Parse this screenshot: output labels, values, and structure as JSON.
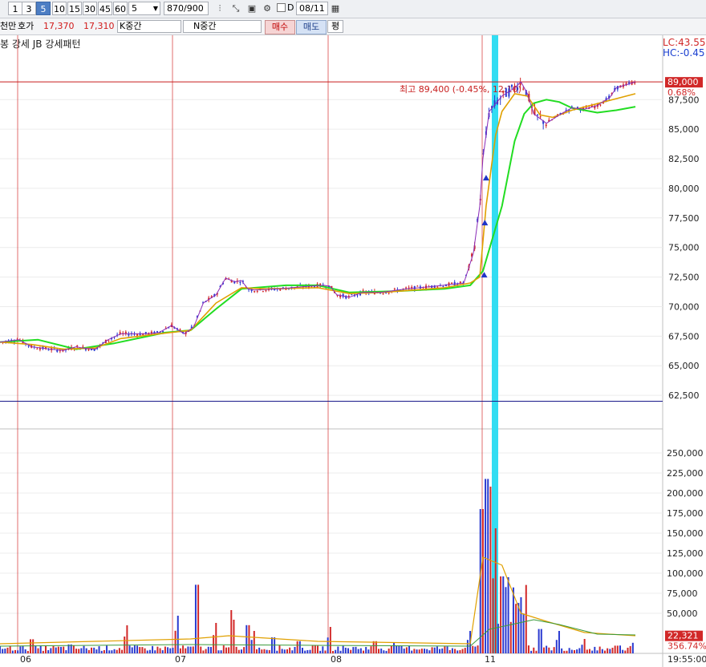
{
  "toolbar": {
    "period_buttons": [
      {
        "label": "1",
        "active": false
      },
      {
        "label": "3",
        "active": false
      },
      {
        "label": "5",
        "active": true
      },
      {
        "label": "10",
        "active": false
      },
      {
        "label": "15",
        "active": false
      },
      {
        "label": "30",
        "active": false
      },
      {
        "label": "45",
        "active": false
      },
      {
        "label": "60",
        "active": false
      }
    ],
    "interval_value": "5",
    "count_value": "870",
    "count_total": "/900",
    "checkbox_label": "D",
    "date_value": "08/11"
  },
  "quote_bar": {
    "left_label": "천만",
    "hoga_label": "호가",
    "ask_price": "17,370",
    "bid_price": "17,310",
    "k_label": "K중간",
    "n_label": "N중간",
    "buy_label": "매수",
    "sell_label": "매도",
    "extra_label": "평"
  },
  "indicator_title": "봉 강세 JB 강세패턴",
  "colors": {
    "accent_cyan": "#33ddf2",
    "ma_short": "#1a33c8",
    "ma_mid": "#e0a000",
    "ma_long": "#22dd22",
    "up": "#d22828",
    "down": "#2a3ad0",
    "grid": "#ececec"
  },
  "chart_data": {
    "type": "candlestick",
    "date_labels": [
      "06",
      "07",
      "08",
      "11"
    ],
    "price_axis": {
      "ticks": [
        "87,500",
        "85,000",
        "82,500",
        "80,000",
        "77,500",
        "75,000",
        "72,500",
        "70,000",
        "67,500",
        "65,000",
        "62,500"
      ],
      "range": [
        60000,
        90500
      ],
      "current_label": "89,000",
      "current_pct": "0.68%",
      "lc_label": "LC:43.55",
      "hc_label": "HC:-0.45"
    },
    "high_annotation": "최고 89,400 (-0.45%, 12:10)",
    "price_reference": 89000,
    "support_reference": 62000,
    "price_path": [
      [
        0,
        67000
      ],
      [
        0.03,
        67200
      ],
      [
        0.05,
        66600
      ],
      [
        0.08,
        66400
      ],
      [
        0.1,
        66300
      ],
      [
        0.12,
        66600
      ],
      [
        0.13,
        66500
      ],
      [
        0.15,
        66400
      ],
      [
        0.17,
        67200
      ],
      [
        0.19,
        67700
      ],
      [
        0.23,
        67700
      ],
      [
        0.25,
        67800
      ],
      [
        0.27,
        68400
      ],
      [
        0.29,
        67700
      ],
      [
        0.305,
        68300
      ],
      [
        0.32,
        70300
      ],
      [
        0.34,
        71000
      ],
      [
        0.355,
        72400
      ],
      [
        0.37,
        72100
      ],
      [
        0.38,
        72200
      ],
      [
        0.39,
        71500
      ],
      [
        0.4,
        71400
      ],
      [
        0.44,
        71500
      ],
      [
        0.48,
        71700
      ],
      [
        0.51,
        71800
      ],
      [
        0.52,
        71700
      ],
      [
        0.53,
        71000
      ],
      [
        0.55,
        70800
      ],
      [
        0.57,
        71200
      ],
      [
        0.6,
        71200
      ],
      [
        0.64,
        71500
      ],
      [
        0.68,
        71700
      ],
      [
        0.73,
        72000
      ],
      [
        0.745,
        74500
      ],
      [
        0.755,
        78500
      ],
      [
        0.76,
        82500
      ],
      [
        0.77,
        86500
      ],
      [
        0.79,
        87800
      ],
      [
        0.81,
        88500
      ],
      [
        0.82,
        89000
      ],
      [
        0.83,
        88000
      ],
      [
        0.84,
        86300
      ],
      [
        0.86,
        85500
      ],
      [
        0.88,
        86200
      ],
      [
        0.9,
        86800
      ],
      [
        0.92,
        86700
      ],
      [
        0.94,
        87000
      ],
      [
        0.96,
        87700
      ],
      [
        0.97,
        88500
      ],
      [
        1.0,
        89000
      ]
    ],
    "ma_mid_path": [
      [
        0,
        67000
      ],
      [
        0.05,
        66800
      ],
      [
        0.1,
        66400
      ],
      [
        0.15,
        66500
      ],
      [
        0.19,
        67300
      ],
      [
        0.25,
        67700
      ],
      [
        0.3,
        68000
      ],
      [
        0.34,
        70300
      ],
      [
        0.38,
        71600
      ],
      [
        0.42,
        71500
      ],
      [
        0.5,
        71600
      ],
      [
        0.55,
        71100
      ],
      [
        0.6,
        71200
      ],
      [
        0.7,
        71600
      ],
      [
        0.74,
        72000
      ],
      [
        0.755,
        72500
      ],
      [
        0.765,
        78500
      ],
      [
        0.78,
        84500
      ],
      [
        0.79,
        86500
      ],
      [
        0.81,
        88000
      ],
      [
        0.83,
        87800
      ],
      [
        0.85,
        86200
      ],
      [
        0.87,
        86000
      ],
      [
        0.9,
        86600
      ],
      [
        0.95,
        87300
      ],
      [
        1.0,
        88000
      ]
    ],
    "ma_long_path": [
      [
        0,
        67000
      ],
      [
        0.06,
        67200
      ],
      [
        0.12,
        66400
      ],
      [
        0.18,
        66900
      ],
      [
        0.26,
        67800
      ],
      [
        0.3,
        68000
      ],
      [
        0.34,
        69800
      ],
      [
        0.38,
        71500
      ],
      [
        0.45,
        71800
      ],
      [
        0.5,
        71800
      ],
      [
        0.55,
        71200
      ],
      [
        0.62,
        71300
      ],
      [
        0.7,
        71500
      ],
      [
        0.74,
        71800
      ],
      [
        0.76,
        73000
      ],
      [
        0.79,
        78500
      ],
      [
        0.81,
        84000
      ],
      [
        0.825,
        86300
      ],
      [
        0.84,
        87200
      ],
      [
        0.86,
        87500
      ],
      [
        0.88,
        87300
      ],
      [
        0.9,
        86800
      ],
      [
        0.94,
        86400
      ],
      [
        0.97,
        86600
      ],
      [
        1.0,
        86900
      ]
    ],
    "volume_axis": {
      "ticks": [
        "250,000",
        "225,000",
        "200,000",
        "175,000",
        "150,000",
        "125,000",
        "100,000",
        "75,000",
        "50,000"
      ],
      "range": [
        0,
        275000
      ],
      "current_label": "22,321",
      "current_pct": "356.74%"
    },
    "volume_spikes": [
      [
        0.05,
        22000
      ],
      [
        0.11,
        14000
      ],
      [
        0.2,
        35000
      ],
      [
        0.28,
        47000
      ],
      [
        0.31,
        107000
      ],
      [
        0.34,
        38000
      ],
      [
        0.365,
        60000
      ],
      [
        0.39,
        44000
      ],
      [
        0.4,
        28000
      ],
      [
        0.43,
        25000
      ],
      [
        0.47,
        19000
      ],
      [
        0.52,
        33000
      ],
      [
        0.59,
        19000
      ],
      [
        0.62,
        14000
      ],
      [
        0.74,
        28000
      ],
      [
        0.758,
        225000
      ],
      [
        0.766,
        272000
      ],
      [
        0.772,
        208000
      ],
      [
        0.78,
        156000
      ],
      [
        0.79,
        120000
      ],
      [
        0.8,
        95000
      ],
      [
        0.82,
        70000
      ],
      [
        0.85,
        38000
      ],
      [
        0.88,
        28000
      ],
      [
        0.92,
        18000
      ],
      [
        0.97,
        12000
      ],
      [
        1.0,
        22000
      ]
    ],
    "time_label": "19:55:00"
  }
}
